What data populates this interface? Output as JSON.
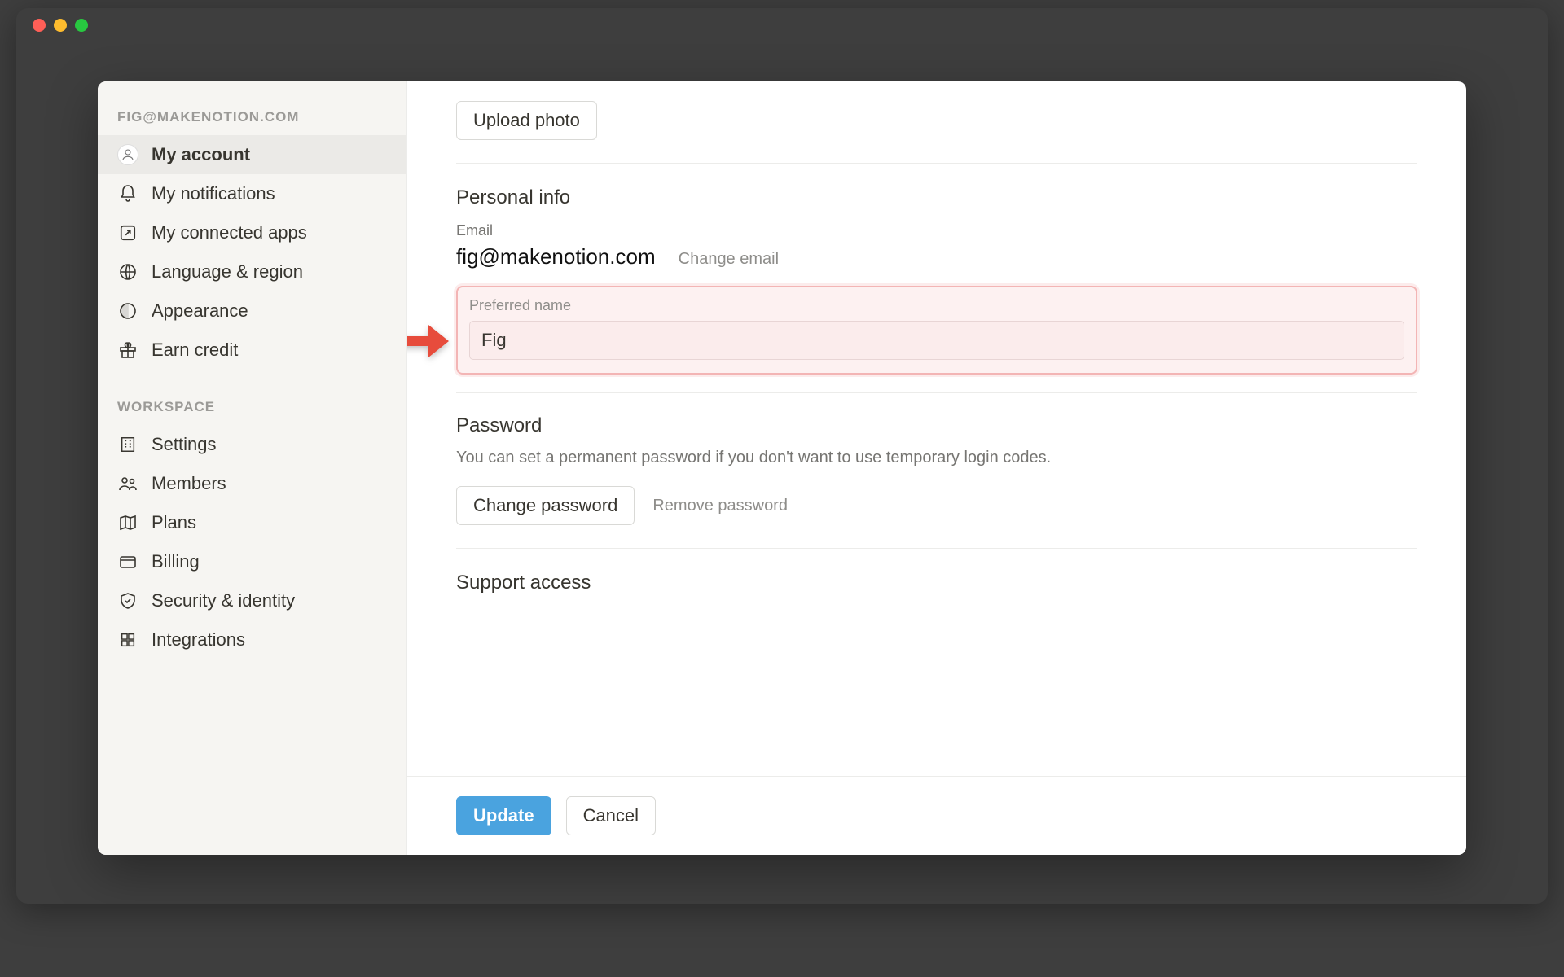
{
  "sidebar": {
    "account_label": "FIG@MAKENOTION.COM",
    "workspace_label": "WORKSPACE",
    "items_account": [
      {
        "label": "My account"
      },
      {
        "label": "My notifications"
      },
      {
        "label": "My connected apps"
      },
      {
        "label": "Language & region"
      },
      {
        "label": "Appearance"
      },
      {
        "label": "Earn credit"
      }
    ],
    "items_workspace": [
      {
        "label": "Settings"
      },
      {
        "label": "Members"
      },
      {
        "label": "Plans"
      },
      {
        "label": "Billing"
      },
      {
        "label": "Security & identity"
      },
      {
        "label": "Integrations"
      }
    ]
  },
  "main": {
    "upload_photo": "Upload photo",
    "personal_info_title": "Personal info",
    "email_label": "Email",
    "email_value": "fig@makenotion.com",
    "change_email": "Change email",
    "preferred_name_label": "Preferred name",
    "preferred_name_value": "Fig",
    "password_title": "Password",
    "password_desc": "You can set a permanent password if you don't want to use temporary login codes.",
    "change_password": "Change password",
    "remove_password": "Remove password",
    "support_access_title": "Support access"
  },
  "footer": {
    "update": "Update",
    "cancel": "Cancel"
  }
}
